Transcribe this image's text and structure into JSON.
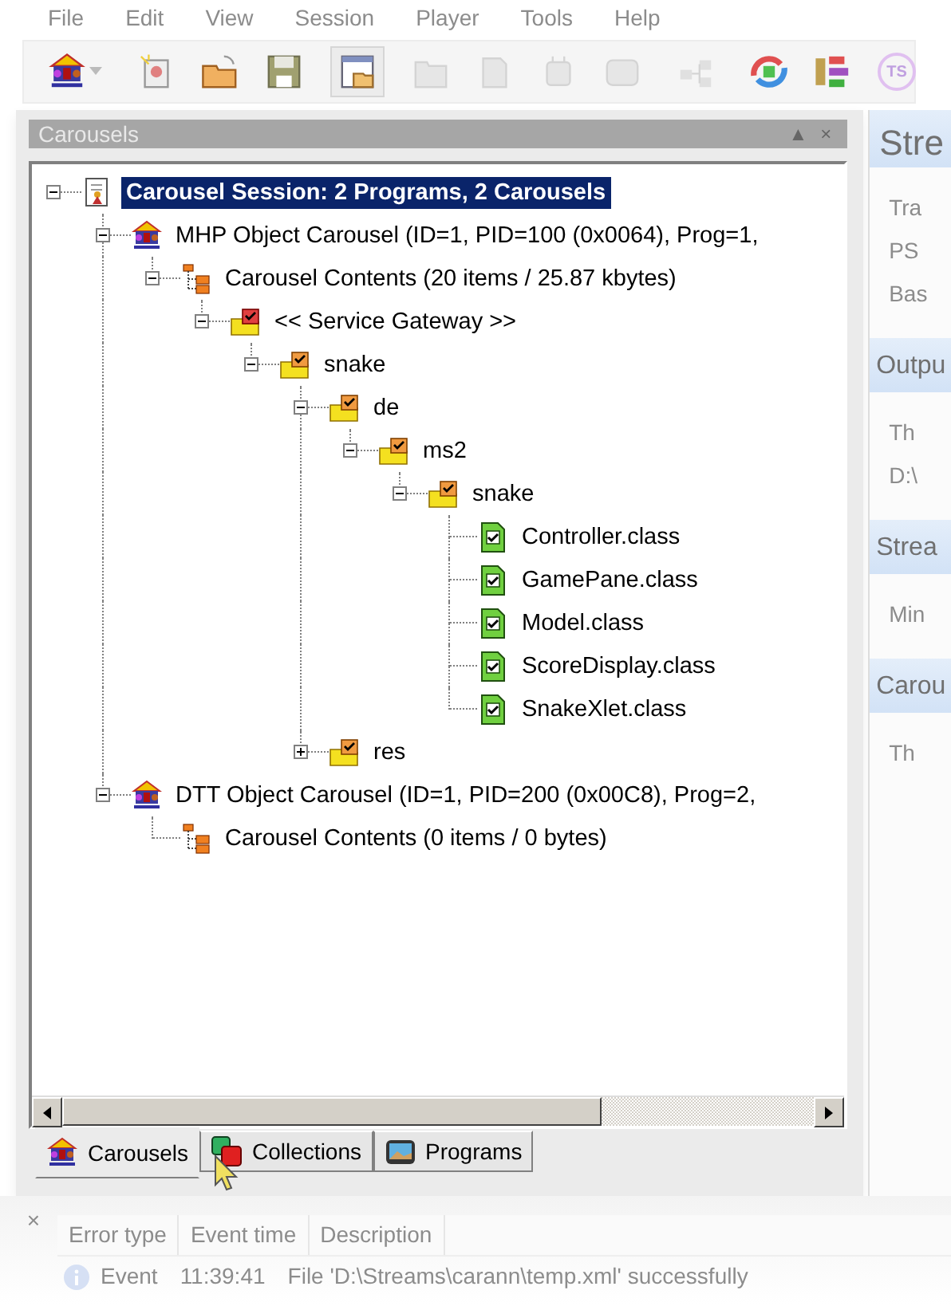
{
  "menu": [
    "File",
    "Edit",
    "View",
    "Session",
    "Player",
    "Tools",
    "Help"
  ],
  "toolbar": [
    {
      "kind": "carousel",
      "dropdown": true,
      "disabled": false,
      "pressed": false
    },
    {
      "kind": "separator"
    },
    {
      "kind": "new",
      "disabled": false,
      "pressed": false
    },
    {
      "kind": "open",
      "disabled": false,
      "pressed": false
    },
    {
      "kind": "save",
      "disabled": false,
      "pressed": false
    },
    {
      "kind": "separator"
    },
    {
      "kind": "view",
      "disabled": false,
      "pressed": true
    },
    {
      "kind": "separator"
    },
    {
      "kind": "folder",
      "disabled": true,
      "pressed": false
    },
    {
      "kind": "page",
      "disabled": true,
      "pressed": false
    },
    {
      "kind": "chip",
      "disabled": true,
      "pressed": false
    },
    {
      "kind": "panel",
      "disabled": true,
      "pressed": false
    },
    {
      "kind": "separator"
    },
    {
      "kind": "network",
      "disabled": true,
      "pressed": false
    },
    {
      "kind": "separator"
    },
    {
      "kind": "transfer",
      "disabled": false,
      "pressed": false
    },
    {
      "kind": "flow",
      "disabled": false,
      "pressed": false
    },
    {
      "kind": "ts",
      "label": "TS",
      "disabled": false,
      "pressed": false
    }
  ],
  "panel": {
    "title": "Carousels",
    "controls": [
      "▲",
      "×"
    ]
  },
  "tree": [
    {
      "kind": "session",
      "label": "Carousel Session: 2 Programs, 2 Carousels",
      "selected": true,
      "expanded": true,
      "children": [
        {
          "kind": "carousel",
          "label": "MHP Object Carousel (ID=1, PID=100 (0x0064), Prog=1,",
          "selected": false,
          "expanded": true,
          "children": [
            {
              "kind": "contents",
              "label": "Carousel Contents (20 items / 25.87 kbytes)",
              "selected": false,
              "expanded": true,
              "children": [
                {
                  "kind": "gateway",
                  "label": "<< Service Gateway >>",
                  "selected": false,
                  "expanded": true,
                  "children": [
                    {
                      "kind": "folder",
                      "label": "snake",
                      "selected": false,
                      "expanded": true,
                      "children": [
                        {
                          "kind": "folder",
                          "label": "de",
                          "selected": false,
                          "expanded": true,
                          "children": [
                            {
                              "kind": "folder",
                              "label": "ms2",
                              "selected": false,
                              "expanded": true,
                              "children": [
                                {
                                  "kind": "folder",
                                  "label": "snake",
                                  "selected": false,
                                  "expanded": true,
                                  "children": [
                                    {
                                      "kind": "file",
                                      "label": "Controller.class",
                                      "selected": false
                                    },
                                    {
                                      "kind": "file",
                                      "label": "GamePane.class",
                                      "selected": false
                                    },
                                    {
                                      "kind": "file",
                                      "label": "Model.class",
                                      "selected": false
                                    },
                                    {
                                      "kind": "file",
                                      "label": "ScoreDisplay.class",
                                      "selected": false
                                    },
                                    {
                                      "kind": "file",
                                      "label": "SnakeXlet.class",
                                      "selected": false
                                    }
                                  ]
                                }
                              ]
                            }
                          ]
                        },
                        {
                          "kind": "folder",
                          "label": "res",
                          "selected": false,
                          "expanded": false
                        }
                      ]
                    }
                  ]
                }
              ]
            }
          ]
        },
        {
          "kind": "carousel",
          "label": "DTT Object Carousel (ID=1, PID=200 (0x00C8), Prog=2,",
          "selected": false,
          "expanded": true,
          "children": [
            {
              "kind": "contents",
              "label": "Carousel Contents (0 items / 0 bytes)",
              "selected": false
            }
          ]
        }
      ]
    }
  ],
  "tabs": [
    {
      "kind": "carousel",
      "label": "Carousels",
      "selected": true
    },
    {
      "kind": "collections",
      "label": "Collections",
      "selected": false
    },
    {
      "kind": "programs",
      "label": "Programs",
      "selected": false
    }
  ],
  "side_sections": [
    {
      "title": "Stre",
      "lines": [
        "Tra",
        "PS",
        "Bas"
      ]
    },
    {
      "title": "Outpu",
      "lines": [
        "Th",
        "D:\\"
      ]
    },
    {
      "title": "Strea",
      "lines": [
        "Min"
      ]
    },
    {
      "title": "Carou",
      "lines": [
        "Th"
      ]
    }
  ],
  "log": {
    "close": "×",
    "columns": [
      "Error type",
      "Event time",
      "Description"
    ],
    "rows": [
      {
        "kind": "info",
        "cells": [
          "Event",
          "11:39:41",
          "File 'D:\\Streams\\carann\\temp.xml' successfully"
        ]
      }
    ]
  }
}
